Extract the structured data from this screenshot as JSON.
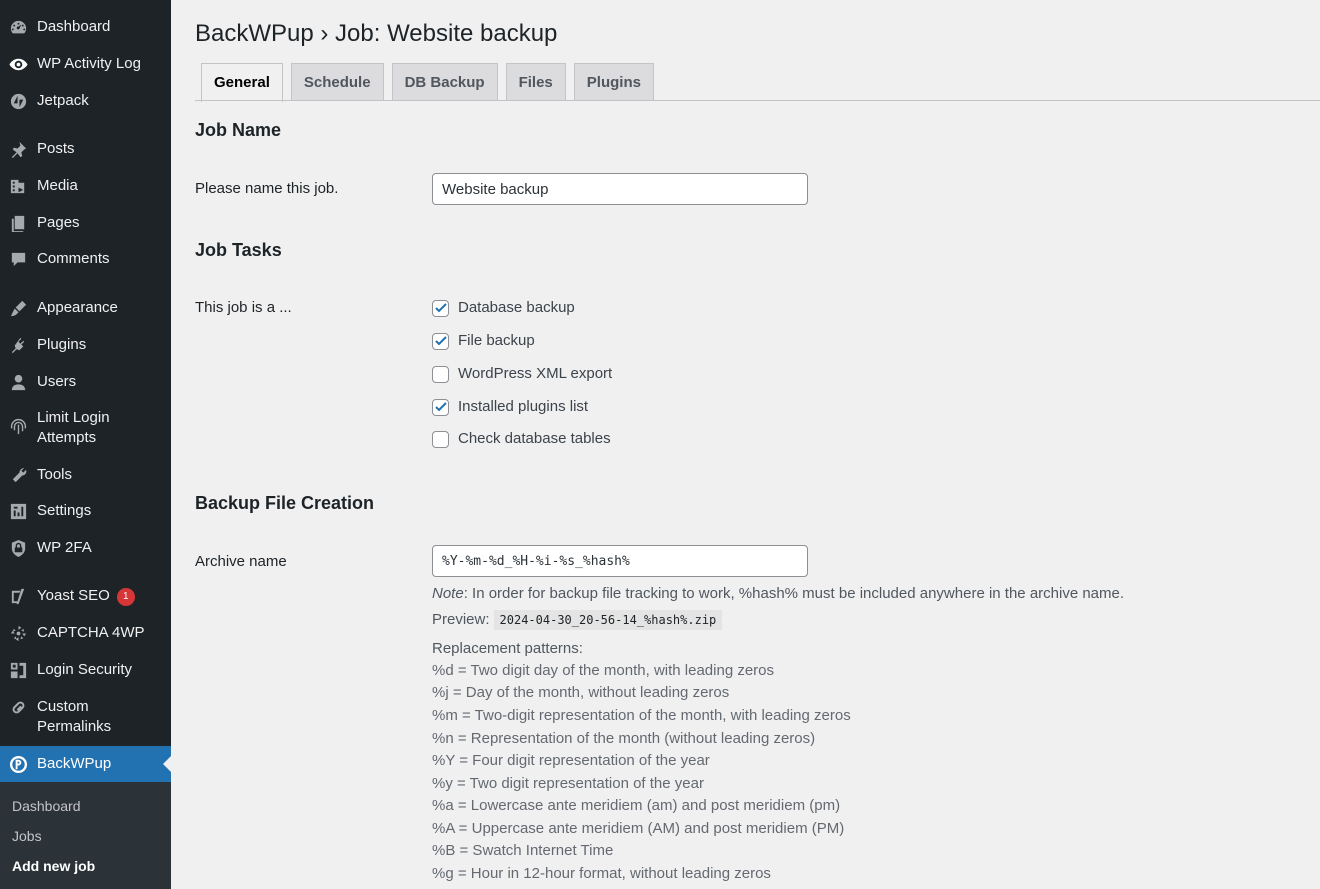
{
  "sidebar": {
    "items": [
      {
        "label": "Dashboard",
        "icon": "dashboard-icon"
      },
      {
        "label": "WP Activity Log",
        "icon": "eye-icon"
      },
      {
        "label": "Jetpack",
        "icon": "jetpack-icon"
      },
      {
        "label": "Posts",
        "icon": "pin-icon"
      },
      {
        "label": "Media",
        "icon": "media-icon"
      },
      {
        "label": "Pages",
        "icon": "pages-icon"
      },
      {
        "label": "Comments",
        "icon": "comment-icon"
      },
      {
        "label": "Appearance",
        "icon": "brush-icon"
      },
      {
        "label": "Plugins",
        "icon": "plugin-icon"
      },
      {
        "label": "Users",
        "icon": "user-icon"
      },
      {
        "label": "Limit Login",
        "label2": "Attempts",
        "icon": "fingerprint-icon"
      },
      {
        "label": "Tools",
        "icon": "wrench-icon"
      },
      {
        "label": "Settings",
        "icon": "settings-icon"
      },
      {
        "label": "WP 2FA",
        "icon": "shield-icon"
      },
      {
        "label": "Yoast SEO",
        "icon": "yoast-icon",
        "badge": "1"
      },
      {
        "label": "CAPTCHA 4WP",
        "icon": "captcha-icon"
      },
      {
        "label": "Login Security",
        "icon": "login-security-icon"
      },
      {
        "label": "Custom",
        "label2": "Permalinks",
        "icon": "link-icon"
      },
      {
        "label": "BackWPup",
        "icon": "backwpup-icon"
      }
    ],
    "submenu": [
      {
        "label": "Dashboard"
      },
      {
        "label": "Jobs"
      },
      {
        "label": "Add new job"
      }
    ]
  },
  "page": {
    "title": "BackWPup › Job: Website backup"
  },
  "tabs": [
    {
      "label": "General"
    },
    {
      "label": "Schedule"
    },
    {
      "label": "DB Backup"
    },
    {
      "label": "Files"
    },
    {
      "label": "Plugins"
    }
  ],
  "job_name": {
    "heading": "Job Name",
    "label": "Please name this job.",
    "value": "Website backup"
  },
  "job_tasks": {
    "heading": "Job Tasks",
    "label": "This job is a ...",
    "options": [
      {
        "label": "Database backup",
        "checked": true
      },
      {
        "label": "File backup",
        "checked": true
      },
      {
        "label": "WordPress XML export",
        "checked": false
      },
      {
        "label": "Installed plugins list",
        "checked": true
      },
      {
        "label": "Check database tables",
        "checked": false
      }
    ]
  },
  "backup_file": {
    "heading": "Backup File Creation",
    "archive_label": "Archive name",
    "archive_value": "%Y-%m-%d_%H-%i-%s_%hash%",
    "note_prefix": "Note",
    "note_text": ": In order for backup file tracking to work, %hash% must be included anywhere in the archive name.",
    "preview_label": "Preview:",
    "preview_value": "2024-04-30_20-56-14_%hash%.zip",
    "patterns_title": "Replacement patterns:",
    "patterns": [
      "%d = Two digit day of the month, with leading zeros",
      "%j = Day of the month, without leading zeros",
      "%m = Two-digit representation of the month, with leading zeros",
      "%n = Representation of the month (without leading zeros)",
      "%Y = Four digit representation of the year",
      "%y = Two digit representation of the year",
      "%a = Lowercase ante meridiem (am) and post meridiem (pm)",
      "%A = Uppercase ante meridiem (AM) and post meridiem (PM)",
      "%B = Swatch Internet Time",
      "%g = Hour in 12-hour format, without leading zeros"
    ]
  },
  "colors": {
    "sidebar_bg": "#1d2327",
    "submenu_bg": "#2c3338",
    "accent": "#2271b1",
    "badge": "#d63638",
    "checkbox_check": "#2271b1",
    "page_bg": "#f0f0f1"
  }
}
